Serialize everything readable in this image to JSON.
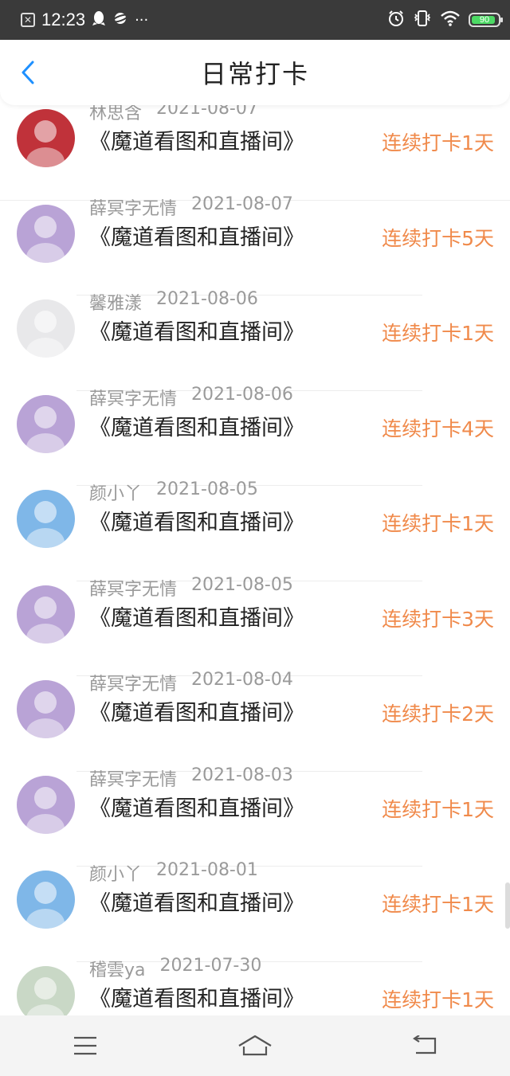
{
  "status_bar": {
    "time": "12:23",
    "battery_level": "90",
    "icons": [
      "close-box-icon",
      "qq-icon",
      "planet-icon",
      "more-dots-icon",
      "alarm-icon",
      "vibrate-icon",
      "wifi-icon",
      "battery-icon"
    ]
  },
  "header": {
    "title": "日常打卡",
    "back_icon": "chevron-left-icon"
  },
  "list": {
    "items": [
      {
        "username": "林思含",
        "date": "2021-08-07",
        "book": "《魔道看图和直播间》",
        "streak": "连续打卡1天",
        "avatar_color": "#c0323a"
      },
      {
        "username": "薛冥字无情",
        "date": "2021-08-07",
        "book": "《魔道看图和直播间》",
        "streak": "连续打卡5天",
        "avatar_color": "#b9a3d6"
      },
      {
        "username": "馨雅漾",
        "date": "2021-08-06",
        "book": "《魔道看图和直播间》",
        "streak": "连续打卡1天",
        "avatar_color": "#e8e8ea"
      },
      {
        "username": "薛冥字无情",
        "date": "2021-08-06",
        "book": "《魔道看图和直播间》",
        "streak": "连续打卡4天",
        "avatar_color": "#b9a3d6"
      },
      {
        "username": "颜小丫",
        "date": "2021-08-05",
        "book": "《魔道看图和直播间》",
        "streak": "连续打卡1天",
        "avatar_color": "#7fb7e8"
      },
      {
        "username": "薛冥字无情",
        "date": "2021-08-05",
        "book": "《魔道看图和直播间》",
        "streak": "连续打卡3天",
        "avatar_color": "#b9a3d6"
      },
      {
        "username": "薛冥字无情",
        "date": "2021-08-04",
        "book": "《魔道看图和直播间》",
        "streak": "连续打卡2天",
        "avatar_color": "#b9a3d6"
      },
      {
        "username": "薛冥字无情",
        "date": "2021-08-03",
        "book": "《魔道看图和直播间》",
        "streak": "连续打卡1天",
        "avatar_color": "#b9a3d6"
      },
      {
        "username": "颜小丫",
        "date": "2021-08-01",
        "book": "《魔道看图和直播间》",
        "streak": "连续打卡1天",
        "avatar_color": "#7fb7e8"
      },
      {
        "username": "稽雲ya",
        "date": "2021-07-30",
        "book": "《魔道看图和直播间》",
        "streak": "连续打卡1天",
        "avatar_color": "#c9d8c6"
      }
    ]
  },
  "nav_bar": {
    "icons": [
      "menu-icon",
      "home-icon",
      "back-icon"
    ]
  },
  "colors": {
    "accent": "#f08a4b",
    "back_arrow": "#1e90ff",
    "status_bar_bg": "#3a3a3a"
  }
}
